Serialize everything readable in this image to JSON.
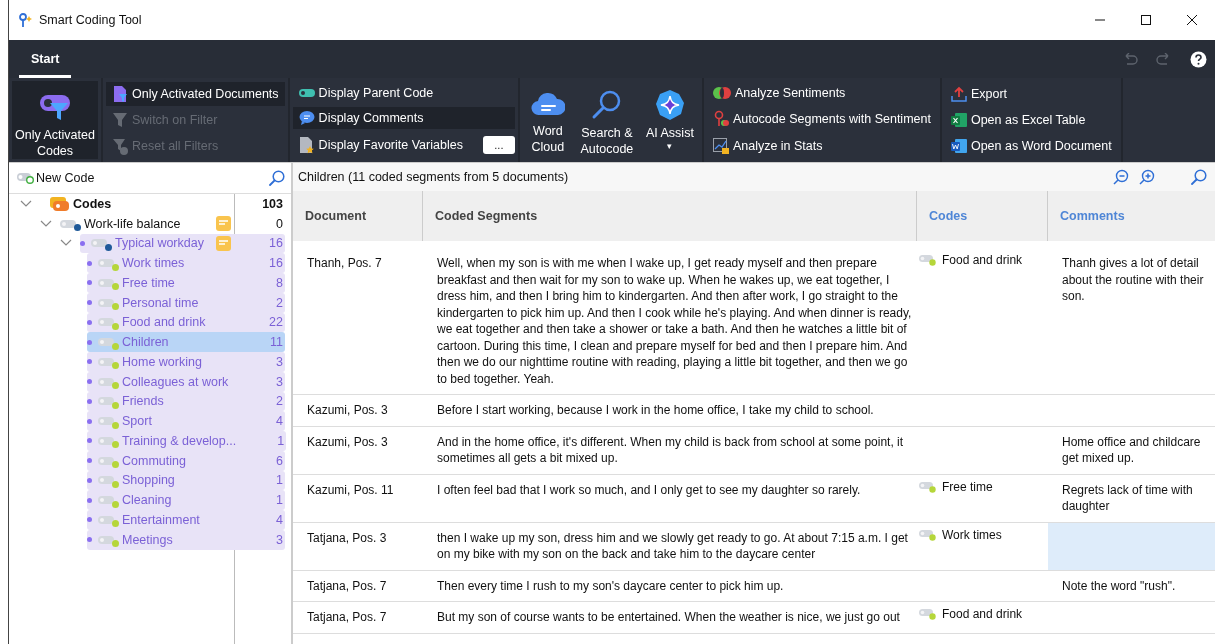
{
  "window": {
    "title": "Smart Coding Tool"
  },
  "tabs": [
    {
      "label": "Start",
      "selected": true
    }
  ],
  "ribbon": {
    "groups": [
      {
        "items": [
          {
            "kind": "large",
            "label": "Only Activated Codes",
            "selected": true,
            "disabled": false
          }
        ]
      },
      {
        "items": [
          {
            "kind": "small",
            "label": "Only Activated Documents",
            "selected": true,
            "disabled": false
          },
          {
            "kind": "small",
            "label": "Switch on Filter",
            "selected": false,
            "disabled": true
          },
          {
            "kind": "small",
            "label": "Reset all Filters",
            "selected": false,
            "disabled": true
          }
        ]
      },
      {
        "items": [
          {
            "kind": "small",
            "label": "Display Parent Code",
            "selected": false,
            "disabled": false
          },
          {
            "kind": "small",
            "label": "Display Comments",
            "selected": true,
            "disabled": false
          },
          {
            "kind": "small",
            "label": "Display Favorite Variables",
            "selected": false,
            "disabled": false,
            "extra": "..."
          }
        ]
      },
      {
        "items": [
          {
            "kind": "large",
            "label": "Word Cloud",
            "selected": false,
            "disabled": false
          },
          {
            "kind": "large",
            "label": "Search & Autocode",
            "selected": false,
            "disabled": false
          },
          {
            "kind": "large",
            "label": "AI Assist",
            "selected": false,
            "disabled": false,
            "dropdown": "▾"
          }
        ]
      },
      {
        "items": [
          {
            "kind": "small",
            "label": "Analyze Sentiments",
            "selected": false,
            "disabled": false
          },
          {
            "kind": "small",
            "label": "Autocode Segments with Sentiment",
            "selected": false,
            "disabled": false
          },
          {
            "kind": "small",
            "label": "Analyze in Stats",
            "selected": false,
            "disabled": false
          }
        ]
      },
      {
        "items": [
          {
            "kind": "small",
            "label": "Export",
            "selected": false,
            "disabled": false
          },
          {
            "kind": "small",
            "label": "Open as Excel Table",
            "selected": false,
            "disabled": false
          },
          {
            "kind": "small",
            "label": "Open as Word Document",
            "selected": false,
            "disabled": false
          }
        ]
      }
    ]
  },
  "code_panel": {
    "new_code": "New Code",
    "tree": [
      {
        "kind": "root",
        "label": "Codes",
        "count": "103",
        "expanded": true,
        "activated": false,
        "selected": false,
        "memo": false,
        "children": [
          {
            "kind": "code",
            "label": "Work-life balance",
            "count": "0",
            "color": "#1f5a99",
            "expanded": true,
            "activated": false,
            "selected": false,
            "memo": true,
            "children": [
              {
                "kind": "code",
                "label": "Typical workday",
                "count": "16",
                "color": "#1f5a99",
                "expanded": true,
                "activated": true,
                "selected": false,
                "memo": true,
                "children": [
                  {
                    "kind": "code",
                    "label": "Work times",
                    "count": "16",
                    "color": "#b5d63a",
                    "activated": true,
                    "selected": false,
                    "memo": false
                  },
                  {
                    "kind": "code",
                    "label": "Free time",
                    "count": "8",
                    "color": "#b5d63a",
                    "activated": true,
                    "selected": false,
                    "memo": false
                  },
                  {
                    "kind": "code",
                    "label": "Personal time",
                    "count": "2",
                    "color": "#b5d63a",
                    "activated": true,
                    "selected": false,
                    "memo": false
                  },
                  {
                    "kind": "code",
                    "label": "Food and drink",
                    "count": "22",
                    "color": "#b5d63a",
                    "activated": true,
                    "selected": false,
                    "memo": false
                  },
                  {
                    "kind": "code",
                    "label": "Children",
                    "count": "11",
                    "color": "#b5d63a",
                    "activated": true,
                    "selected": true,
                    "memo": false
                  },
                  {
                    "kind": "code",
                    "label": "Home working",
                    "count": "3",
                    "color": "#b5d63a",
                    "activated": true,
                    "selected": false,
                    "memo": false
                  },
                  {
                    "kind": "code",
                    "label": "Colleagues at work",
                    "count": "3",
                    "color": "#b5d63a",
                    "activated": true,
                    "selected": false,
                    "memo": false
                  },
                  {
                    "kind": "code",
                    "label": "Friends",
                    "count": "2",
                    "color": "#b5d63a",
                    "activated": true,
                    "selected": false,
                    "memo": false
                  },
                  {
                    "kind": "code",
                    "label": "Sport",
                    "count": "4",
                    "color": "#b5d63a",
                    "activated": true,
                    "selected": false,
                    "memo": false
                  },
                  {
                    "kind": "code",
                    "label": "Training & develop...",
                    "count": "1",
                    "color": "#b5d63a",
                    "activated": true,
                    "selected": false,
                    "memo": false
                  },
                  {
                    "kind": "code",
                    "label": "Commuting",
                    "count": "6",
                    "color": "#b5d63a",
                    "activated": true,
                    "selected": false,
                    "memo": false
                  },
                  {
                    "kind": "code",
                    "label": "Shopping",
                    "count": "1",
                    "color": "#b5d63a",
                    "activated": true,
                    "selected": false,
                    "memo": false
                  },
                  {
                    "kind": "code",
                    "label": "Cleaning",
                    "count": "1",
                    "color": "#b5d63a",
                    "activated": true,
                    "selected": false,
                    "memo": false
                  },
                  {
                    "kind": "code",
                    "label": "Entertainment",
                    "count": "4",
                    "color": "#b5d63a",
                    "activated": true,
                    "selected": false,
                    "memo": false
                  },
                  {
                    "kind": "code",
                    "label": "Meetings",
                    "count": "3",
                    "color": "#b5d63a",
                    "activated": true,
                    "selected": false,
                    "memo": false
                  }
                ]
              }
            ]
          }
        ]
      }
    ]
  },
  "segments": {
    "title": "Children (11 coded segments from 5 documents)",
    "columns": [
      {
        "label": "Document",
        "accent": false
      },
      {
        "label": "Coded Segments",
        "accent": false
      },
      {
        "label": "Codes",
        "accent": true
      },
      {
        "label": "Comments",
        "accent": true
      }
    ],
    "rows": [
      {
        "document": "Thanh, Pos. 7",
        "segment": "Well, when my son is with me when I wake up, I get ready myself and then prepare breakfast and then wait for my son to wake up. When he wakes up, we eat together, I dress him, and then I bring him to kindergarten.  And then after work, I go straight to the kindergarten to pick him up.  And then I cook while he's playing. And when dinner is ready, we eat together and then take a shower or take a bath. And then he watches a little bit of cartoon. During this time, I clean and prepare myself for bed and then I prepare him. And then we do our nighttime routine with reading, playing a little bit together, and then we go to bed together. Yeah.",
        "code": "Food and drink",
        "comment": "Thanh gives a lot of detail about the routine with their son.",
        "comment_selected": false
      },
      {
        "document": "Kazumi, Pos. 3",
        "segment": "Before I start working, because I work in the home office, I take my child to school.",
        "comment_selected": false
      },
      {
        "document": "Kazumi, Pos. 3",
        "segment": "And in the home office, it's different. When my child is back from school at some point, it sometimes all gets a bit mixed up.",
        "comment": "Home office and childcare get mixed up.",
        "comment_selected": false
      },
      {
        "document": "Kazumi, Pos. 11",
        "segment": "I often feel bad that I work so much, and I only get to see my daughter so rarely.",
        "code": "Free time",
        "comment": "Regrets lack of time with daughter",
        "comment_selected": false
      },
      {
        "document": "Tatjana, Pos. 3",
        "segment": "then I wake up my son, dress him and we slowly get ready to go. At about 7:15 a.m. I get on my bike with my son on the back and take him to the daycare center",
        "code": "Work times",
        "comment_selected": true
      },
      {
        "document": "Tatjana, Pos. 7",
        "segment": "Then every time I rush to my son's daycare center to pick him up.",
        "comment": "Note the word \"rush\".",
        "comment_selected": false
      },
      {
        "document": "Tatjana, Pos. 7",
        "segment": "But my son of course wants to be entertained. When the weather is nice, we just go out",
        "code": "Food and drink",
        "comment_selected": false
      }
    ]
  }
}
